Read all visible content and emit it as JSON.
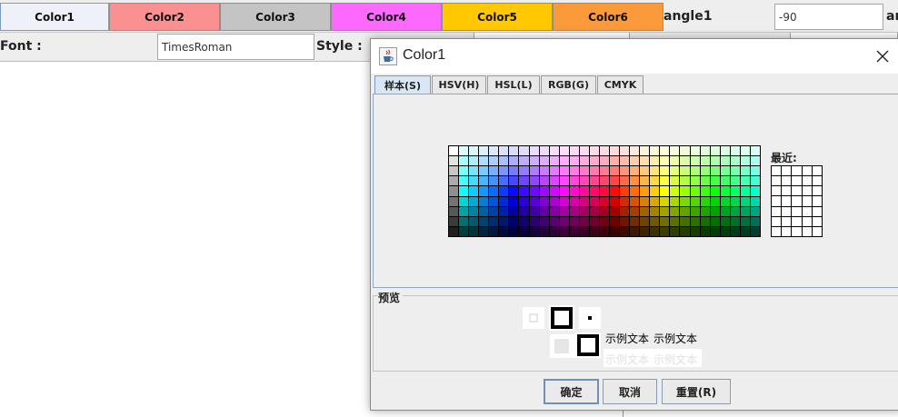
{
  "toolbar": {
    "buttons": [
      {
        "label": "Color1",
        "color": "#eef2f8"
      },
      {
        "label": "Color2",
        "color": "#fa9090"
      },
      {
        "label": "Color3",
        "color": "#c4c4c4"
      },
      {
        "label": "Color4",
        "color": "#fd68fd"
      },
      {
        "label": "Color5",
        "color": "#ffc800"
      },
      {
        "label": "Color6",
        "color": "#fb9a3a"
      }
    ],
    "angle_label": "angle1",
    "angle_value": "-90",
    "right_label_fragment": "ar"
  },
  "font_row": {
    "font_label": "Font :",
    "font_value": "TimesRoman",
    "style_label": "Style :"
  },
  "dialog": {
    "title": "Color1",
    "tabs": [
      "样本(S)",
      "HSV(H)",
      "HSL(L)",
      "RGB(G)",
      "CMYK"
    ],
    "recent_label": "最近:",
    "preview_label": "预览",
    "sample_text_1": "示例文本",
    "sample_text_2": "示例文本",
    "sample_text_3": "示例文本",
    "sample_text_4": "示例文本",
    "buttons": {
      "ok": "确定",
      "cancel": "取消",
      "reset": "重置(R)"
    }
  }
}
